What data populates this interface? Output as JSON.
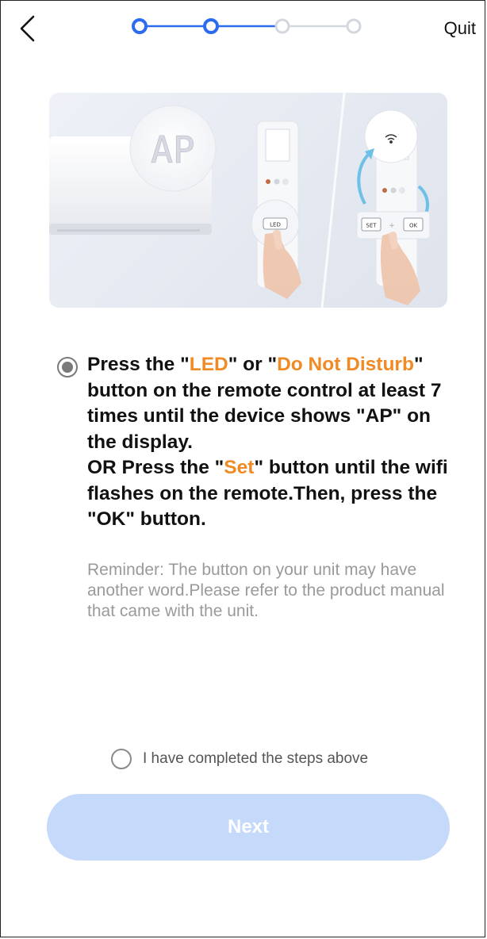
{
  "header": {
    "quit_label": "Quit",
    "progress": {
      "current_step": 2,
      "total_steps": 4
    }
  },
  "illustration": {
    "display_text": "AP",
    "led_button_label": "LED",
    "set_button_label": "SET",
    "plus_label": "+",
    "ok_button_label": "OK"
  },
  "instruction": {
    "p1_a": "Press the \"",
    "p1_b": "LED",
    "p1_c": "\" or \"",
    "p1_d": "Do Not Disturb",
    "p1_e": "\" button on the remote control at least 7 times until the device shows \"AP\" on the display.",
    "p2_a": "OR Press the \"",
    "p2_b": "Set",
    "p2_c": "\" button until the wifi flashes on the remote.Then, press the \"OK\" button."
  },
  "reminder": "Reminder: The button on your unit may have another word.Please refer to the product manual that came with the unit.",
  "confirm_label": "I have completed the steps above",
  "next_label": "Next",
  "colors": {
    "accent": "#2b6cf0",
    "highlight": "#f08a24",
    "next_disabled": "#c5d9fb",
    "step_inactive": "#d3d7de"
  }
}
